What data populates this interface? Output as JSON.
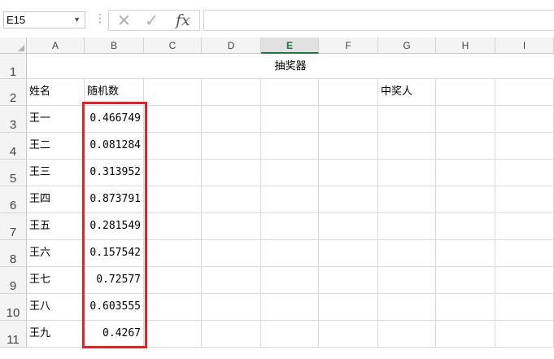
{
  "formula_bar": {
    "name_box": "E15",
    "cancel_icon": "✕",
    "enter_icon": "✓",
    "function_icon": "fx",
    "formula_value": ""
  },
  "columns": [
    "A",
    "B",
    "C",
    "D",
    "E",
    "F",
    "G",
    "H",
    "I"
  ],
  "selected_column": "E",
  "rows": [
    "1",
    "2",
    "3",
    "4",
    "5",
    "6",
    "7",
    "8",
    "9",
    "10",
    "11"
  ],
  "sheet": {
    "title": "抽奖器",
    "headers": {
      "name": "姓名",
      "random": "随机数",
      "winner": "中奖人"
    },
    "entries": [
      {
        "name": "王一",
        "random": "0.466749"
      },
      {
        "name": "王二",
        "random": "0.081284"
      },
      {
        "name": "王三",
        "random": "0.313952"
      },
      {
        "name": "王四",
        "random": "0.873791"
      },
      {
        "name": "王五",
        "random": "0.281549"
      },
      {
        "name": "王六",
        "random": "0.157542"
      },
      {
        "name": "王七",
        "random": "0.72577"
      },
      {
        "name": "王八",
        "random": "0.603555"
      },
      {
        "name": "王九",
        "random": "0.4267"
      }
    ]
  },
  "highlight_color": "#e0222b",
  "accent_color": "#217346"
}
